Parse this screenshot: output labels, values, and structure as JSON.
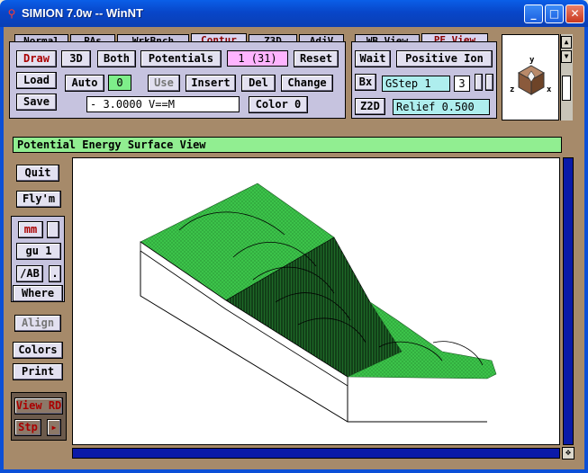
{
  "window": {
    "title": "SIMION 7.0w -- WinNT",
    "controls": {
      "minimize": "_",
      "maximize": "□",
      "close": "✕"
    }
  },
  "tabs_left": [
    "Normal",
    "PAs",
    "WrkBnch",
    "Contur",
    "Z3D",
    "AdjV"
  ],
  "active_tab_left": "Contur",
  "tabs_right": [
    "WB View",
    "PE View"
  ],
  "active_tab_right": "PE View",
  "contour": {
    "draw": "Draw",
    "b3d": "3D",
    "both": "Both",
    "potentials": "Potentials",
    "index": "1 (31)",
    "reset": "Reset",
    "load": "Load",
    "save": "Save",
    "auto": "Auto",
    "auto_value": "0",
    "use": "Use",
    "insert": "Insert",
    "del": "Del",
    "change": "Change",
    "level_field": "-         3.0000 V==M",
    "color": "Color 0"
  },
  "pe_view": {
    "wait": "Wait",
    "ion": "Positive Ion",
    "bx": "Bx",
    "gstep": "GStep  1",
    "gstep_num": "3",
    "z2d": "Z2D",
    "relief": "Relief 0.500"
  },
  "orientation": {
    "x": "x",
    "y": "y",
    "z": "z"
  },
  "view_title": "Potential Energy Surface View",
  "left_panel": {
    "quit": "Quit",
    "flym": "Fly'm",
    "mm": "mm",
    "gu": "gu  1",
    "ab": "/AB",
    "dot": ".",
    "where": "Where",
    "align": "Align",
    "colors": "Colors",
    "print": "Print",
    "view_rd": "View RD",
    "stp": "Stp",
    "stp_arrow": "▸"
  },
  "colors": {
    "surface": "#3cc34a",
    "panel": "#c6c3df",
    "frame": "#a68a6a",
    "scroll": "#0a1aa8"
  }
}
